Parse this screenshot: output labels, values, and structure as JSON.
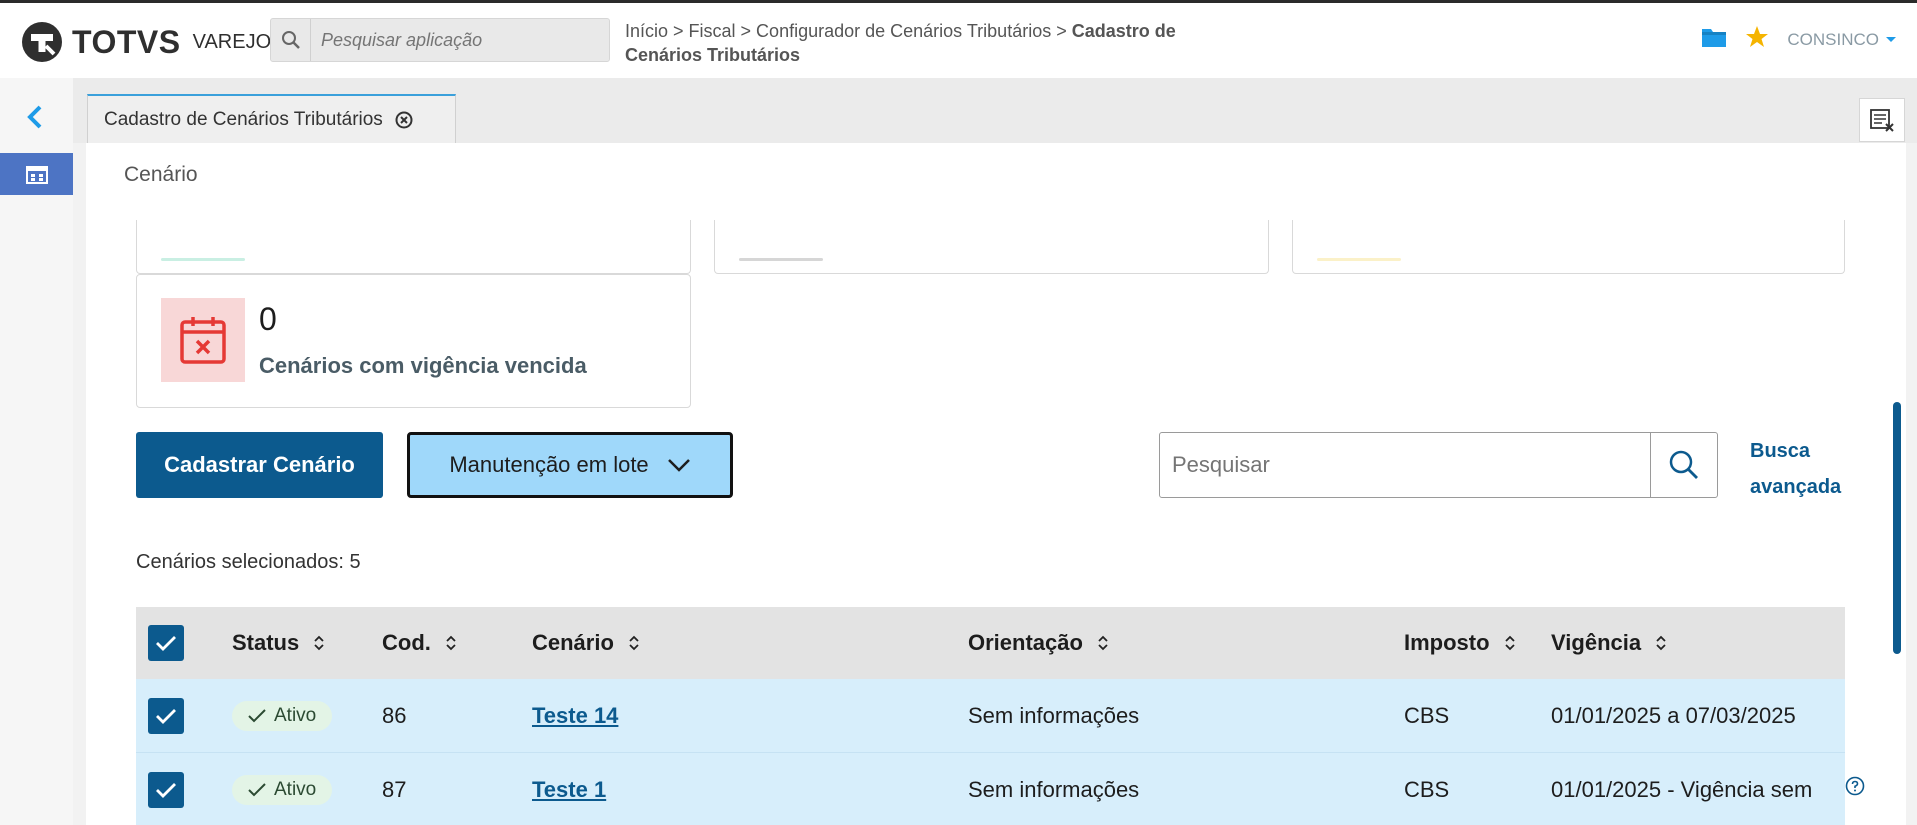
{
  "brand": {
    "name": "TOTVS",
    "product": "VAREJO"
  },
  "app_search": {
    "placeholder": "Pesquisar aplicação"
  },
  "breadcrumb": {
    "path": "Início > Fiscal > Configurador de Cenários Tributários > ",
    "current": "Cadastro de Cenários Tributários"
  },
  "header": {
    "company": "CONSINCO",
    "icons": [
      "folder-icon",
      "star-icon"
    ]
  },
  "colors": {
    "primary": "#0c5a8e",
    "accent": "#3aa0db",
    "star": "#f5b400",
    "danger": "#e53935",
    "row_selected": "#d7eefb"
  },
  "tab": {
    "label": "Cadastro de Cenários Tributários"
  },
  "panel": {
    "title": "Cenário"
  },
  "expired_card": {
    "count": "0",
    "label": "Cenários com vigência vencida"
  },
  "actions": {
    "create_label": "Cadastrar Cenário",
    "batch_label": "Manutenção em lote"
  },
  "search": {
    "placeholder": "Pesquisar",
    "advanced_label": "Busca avançada"
  },
  "selection": {
    "text": "Cenários selecionados: 5"
  },
  "table": {
    "columns": [
      "Status",
      "Cod.",
      "Cenário",
      "Orientação",
      "Imposto",
      "Vigência"
    ],
    "rows": [
      {
        "status": "Ativo",
        "cod": "86",
        "cenario": "Teste 14",
        "orientacao": "Sem informações",
        "imposto": "CBS",
        "vigencia": "01/01/2025 a 07/03/2025"
      },
      {
        "status": "Ativo",
        "cod": "87",
        "cenario": "Teste 1",
        "orientacao": "Sem informações",
        "imposto": "CBS",
        "vigencia": "01/01/2025 - Vigência sem"
      }
    ]
  }
}
